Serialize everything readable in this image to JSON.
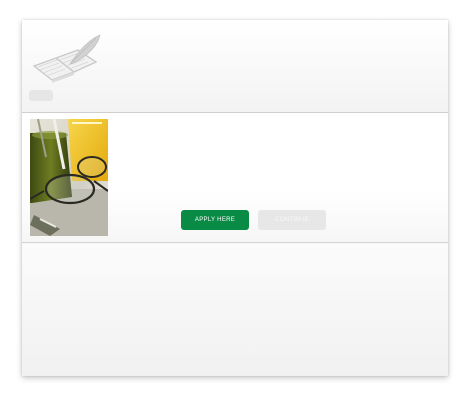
{
  "header": {
    "logo_icon": "book-and-quill-icon"
  },
  "content": {
    "image_icon": "lab-glassware-and-glasses-photo",
    "apply_button_label": "APPLY HERE",
    "secondary_button_label": "CONTINUE"
  },
  "colors": {
    "apply_green": "#0a8b45",
    "secondary_gray": "#e7e7e7"
  }
}
